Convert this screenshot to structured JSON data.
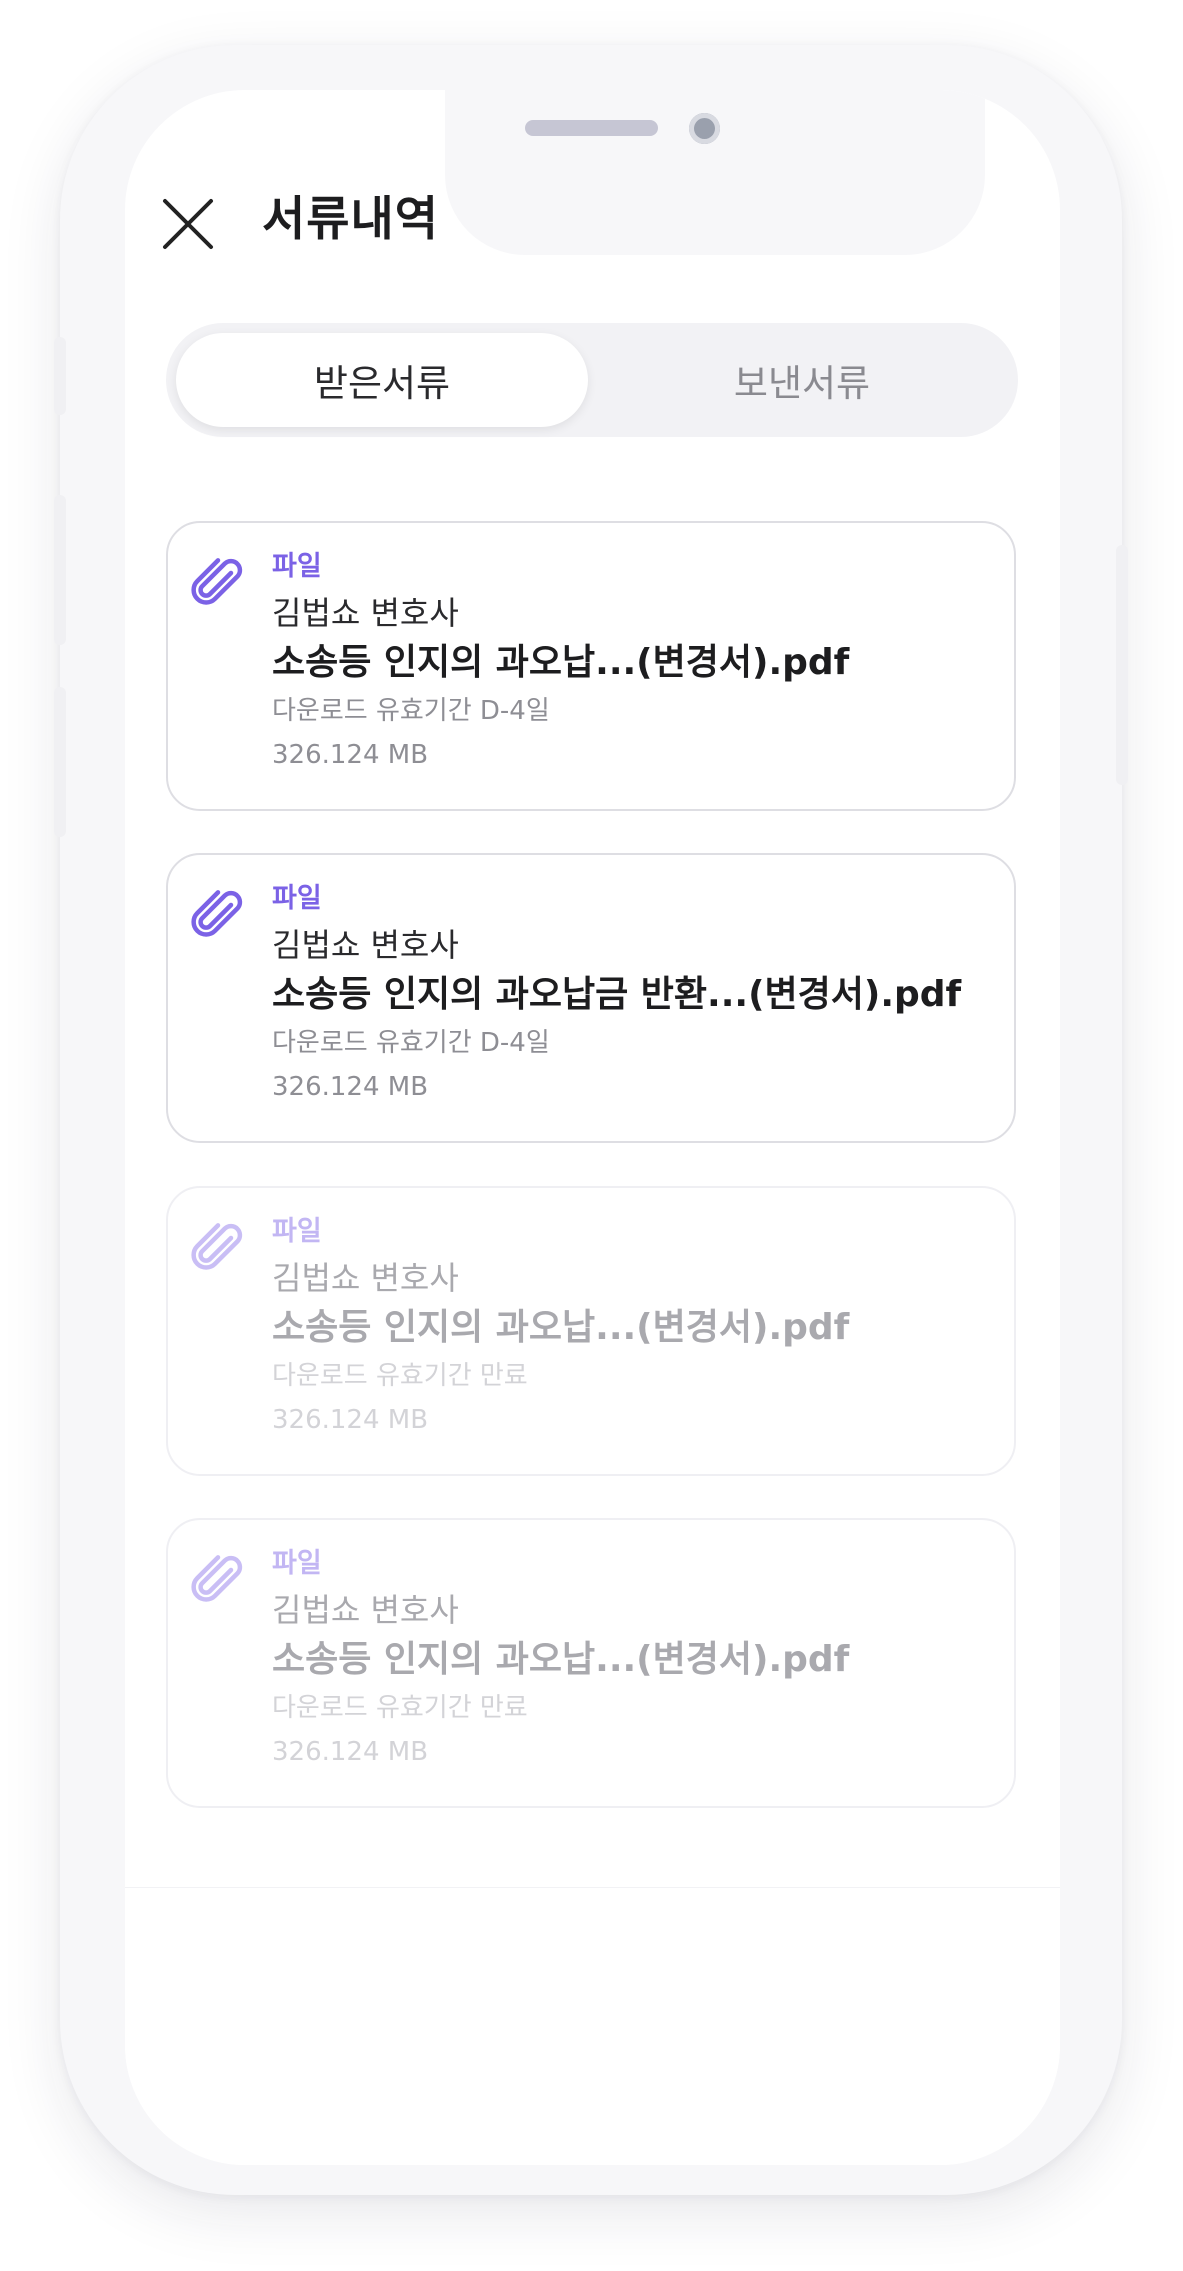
{
  "header": {
    "title": "서류내역"
  },
  "tabs": [
    {
      "label": "받은서류",
      "active": true
    },
    {
      "label": "보낸서류",
      "active": false
    }
  ],
  "documents": [
    {
      "type": "파일",
      "sender": "김법쇼 변호사",
      "filename": "소송등 인지의 과오납...(변경서).pdf",
      "expiry": "다운로드 유효기간 D-4일",
      "size": "326.124 MB",
      "expired": false
    },
    {
      "type": "파일",
      "sender": "김법쇼 변호사",
      "filename": "소송등 인지의 과오납금 반환...(변경서).pdf",
      "expiry": "다운로드 유효기간 D-4일",
      "size": "326.124 MB",
      "expired": false
    },
    {
      "type": "파일",
      "sender": "김법쇼 변호사",
      "filename": "소송등 인지의 과오납...(변경서).pdf",
      "expiry": "다운로드 유효기간 만료",
      "size": "326.124 MB",
      "expired": true
    },
    {
      "type": "파일",
      "sender": "김법쇼 변호사",
      "filename": "소송등 인지의 과오납...(변경서).pdf",
      "expiry": "다운로드 유효기간 만료",
      "size": "326.124 MB",
      "expired": true
    }
  ],
  "colors": {
    "accent": "#7b62e6",
    "accent_faded": "#c2b6f3",
    "text": "#1d1d1f"
  },
  "icons": {
    "close": "close-icon",
    "attachment": "paperclip-icon"
  }
}
